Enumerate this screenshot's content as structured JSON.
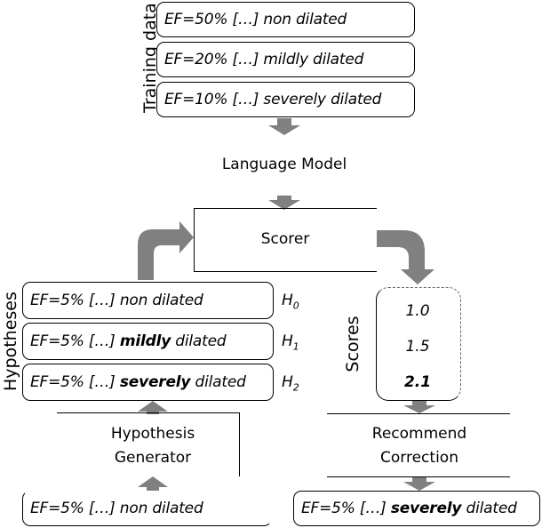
{
  "training_data": {
    "label": "Training data",
    "items": [
      "EF=50% […] non dilated",
      "EF=20% […] mildly dilated",
      "EF=10% […] severely dilated"
    ]
  },
  "language_model": {
    "label": "Language Model"
  },
  "scorer": {
    "label": "Scorer"
  },
  "hypotheses": {
    "label": "Hypotheses",
    "items": [
      {
        "prefix": "EF=5% […] ",
        "emphasis": "",
        "suffix": "non dilated",
        "tag": "H",
        "tag_sub": "0"
      },
      {
        "prefix": "EF=5% […] ",
        "emphasis": "mildly",
        "suffix": " dilated",
        "tag": "H",
        "tag_sub": "1"
      },
      {
        "prefix": "EF=5% […] ",
        "emphasis": "severely",
        "suffix": " dilated",
        "tag": "H",
        "tag_sub": "2"
      }
    ]
  },
  "scores": {
    "label": "Scores",
    "values": [
      "1.0",
      "1.5",
      "2.1"
    ],
    "best_index": 2
  },
  "hypothesis_generator": {
    "line1": "Hypothesis",
    "line2": "Generator"
  },
  "recommend_correction": {
    "line1": "Recommend",
    "line2": "Correction"
  },
  "input": {
    "text": "EF=5% […] non dilated"
  },
  "output": {
    "prefix": "EF=5% […] ",
    "emphasis": "severely",
    "suffix": " dilated"
  },
  "colors": {
    "arrow": "#808080",
    "line": "#000000"
  }
}
